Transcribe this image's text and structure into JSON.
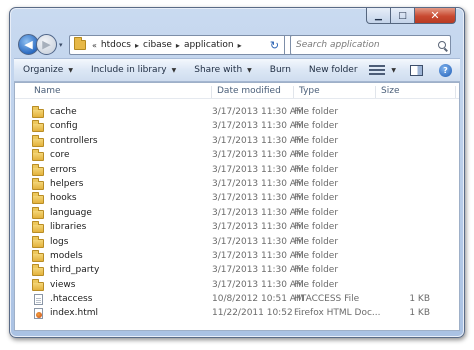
{
  "window": {
    "minimize_glyph": "▁",
    "maximize_glyph": "□",
    "close_glyph": "✕"
  },
  "nav": {
    "back_glyph": "◀",
    "forward_glyph": "▶",
    "recent_glyph": "▾"
  },
  "address": {
    "overflow_glyph": "«",
    "crumbs": [
      "htdocs",
      "cibase",
      "application"
    ],
    "separator_glyph": "▸",
    "dropdown_glyph": "▾",
    "refresh_glyph": "↻"
  },
  "search": {
    "placeholder": "Search application"
  },
  "toolbar": {
    "organize": "Organize",
    "include_in_library": "Include in library",
    "share_with": "Share with",
    "burn": "Burn",
    "new_folder": "New folder",
    "help_glyph": "?"
  },
  "columns": {
    "name": "Name",
    "date_modified": "Date modified",
    "type": "Type",
    "size": "Size"
  },
  "files": [
    {
      "name": "cache",
      "date": "3/17/2013 11:30 AM",
      "type": "File folder",
      "size": "",
      "icon": "folder-icon"
    },
    {
      "name": "config",
      "date": "3/17/2013 11:30 AM",
      "type": "File folder",
      "size": "",
      "icon": "folder-icon"
    },
    {
      "name": "controllers",
      "date": "3/17/2013 11:30 AM",
      "type": "File folder",
      "size": "",
      "icon": "folder-icon"
    },
    {
      "name": "core",
      "date": "3/17/2013 11:30 AM",
      "type": "File folder",
      "size": "",
      "icon": "folder-icon"
    },
    {
      "name": "errors",
      "date": "3/17/2013 11:30 AM",
      "type": "File folder",
      "size": "",
      "icon": "folder-icon"
    },
    {
      "name": "helpers",
      "date": "3/17/2013 11:30 AM",
      "type": "File folder",
      "size": "",
      "icon": "folder-icon"
    },
    {
      "name": "hooks",
      "date": "3/17/2013 11:30 AM",
      "type": "File folder",
      "size": "",
      "icon": "folder-icon"
    },
    {
      "name": "language",
      "date": "3/17/2013 11:30 AM",
      "type": "File folder",
      "size": "",
      "icon": "folder-icon"
    },
    {
      "name": "libraries",
      "date": "3/17/2013 11:30 AM",
      "type": "File folder",
      "size": "",
      "icon": "folder-icon"
    },
    {
      "name": "logs",
      "date": "3/17/2013 11:30 AM",
      "type": "File folder",
      "size": "",
      "icon": "folder-icon"
    },
    {
      "name": "models",
      "date": "3/17/2013 11:30 AM",
      "type": "File folder",
      "size": "",
      "icon": "folder-icon"
    },
    {
      "name": "third_party",
      "date": "3/17/2013 11:30 AM",
      "type": "File folder",
      "size": "",
      "icon": "folder-icon"
    },
    {
      "name": "views",
      "date": "3/17/2013 11:30 AM",
      "type": "File folder",
      "size": "",
      "icon": "folder-icon"
    },
    {
      "name": ".htaccess",
      "date": "10/8/2012 10:51 AM",
      "type": "HTACCESS File",
      "size": "1 KB",
      "icon": "document-icon"
    },
    {
      "name": "index.html",
      "date": "11/22/2011 10:52 ...",
      "type": "Firefox HTML Doc...",
      "size": "1 KB",
      "icon": "html-file-icon"
    }
  ]
}
